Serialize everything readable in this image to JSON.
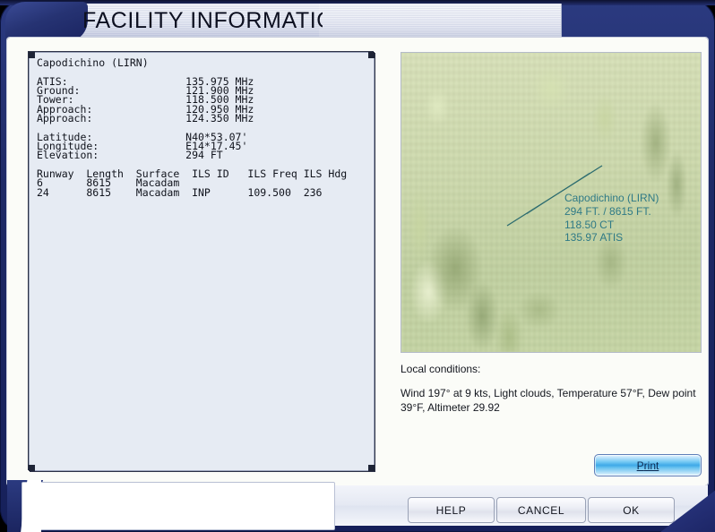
{
  "window": {
    "title": "FACILITY INFORMATION"
  },
  "facility": {
    "name_line": "Capodichino (LIRN)",
    "frequencies": [
      {
        "label": "ATIS:",
        "value": "135.975 MHz"
      },
      {
        "label": "Ground:",
        "value": "121.900 MHz"
      },
      {
        "label": "Tower:",
        "value": "118.500 MHz"
      },
      {
        "label": "Approach:",
        "value": "120.950 MHz"
      },
      {
        "label": "Approach:",
        "value": "124.350 MHz"
      }
    ],
    "position": [
      {
        "label": "Latitude:",
        "value": "N40*53.07'"
      },
      {
        "label": "Longitude:",
        "value": "E14*17.45'"
      },
      {
        "label": "Elevation:",
        "value": "294 FT"
      }
    ],
    "runway_headers": [
      "Runway",
      "Length",
      "Surface",
      "ILS ID",
      "ILS Freq",
      "ILS Hdg"
    ],
    "runways": [
      {
        "runway": "6",
        "length": "8615",
        "surface": "Macadam",
        "ils_id": "",
        "ils_freq": "",
        "ils_hdg": ""
      },
      {
        "runway": "24",
        "length": "8615",
        "surface": "Macadam",
        "ils_id": "INP",
        "ils_freq": "109.500",
        "ils_hdg": "236"
      }
    ],
    "info_block": "Capodichino (LIRN)\n\nATIS:                   135.975 MHz\nGround:                 121.900 MHz\nTower:                  118.500 MHz\nApproach:               120.950 MHz\nApproach:               124.350 MHz\n\nLatitude:               N40*53.07'\nLongitude:              E14*17.45'\nElevation:              294 FT\n\nRunway  Length  Surface  ILS ID   ILS Freq ILS Hdg\n6       8615    Macadam\n24      8615    Macadam  INP      109.500  236"
  },
  "map": {
    "label_lines": "Capodichino (LIRN)\n294 FT. / 8615 FT.\n118.50 CT\n135.97 ATIS",
    "label_color": "#2f7a86",
    "runway_line_color": "#2b6b6f",
    "terrain_base_color": "#cfdcae"
  },
  "conditions": {
    "heading": "Local conditions:",
    "text": "Wind 197° at 9 kts, Light clouds, Temperature 57°F, Dew point 39°F, Altimeter 29.92"
  },
  "buttons": {
    "print": "Print",
    "print_accelerator": "P",
    "print_rest": "rint",
    "help": "HELP",
    "cancel": "CANCEL",
    "ok": "OK"
  },
  "theme": {
    "frame_navy": "#1e2a66",
    "panel_bg": "#e6ebf3",
    "body_bg": "#fbfcf8",
    "accent_blue": "#3ea9e8"
  }
}
